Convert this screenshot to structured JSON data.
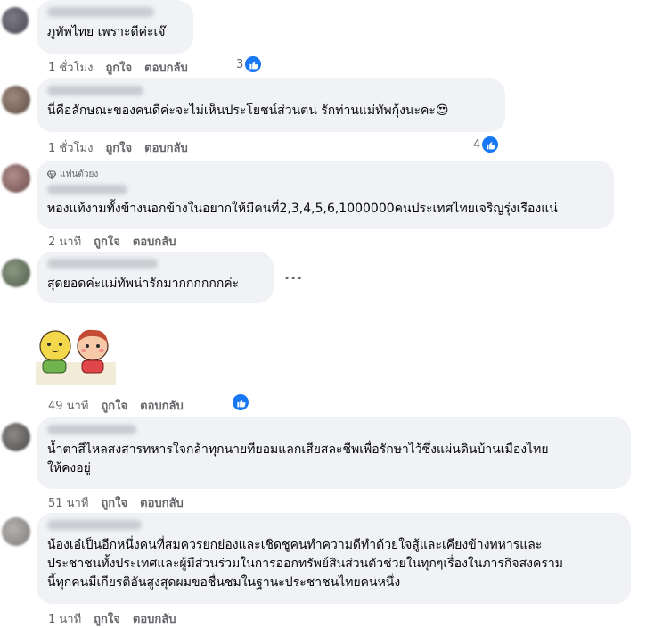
{
  "comments": [
    {
      "text": "ภูทัพไทย เพราะดีค่ะเจ๊",
      "time": "1 ชั่วโมง",
      "like": "ถูกใจ",
      "reply": "ตอบกลับ",
      "reactions": "3"
    },
    {
      "text": "นี่คือลักษณะของคนดีค่ะจะไม่เห็นประโยชน์ส่วนตน รักท่านแม่ทัพกุ้งนะคะ😍",
      "time": "1 ชั่วโมง",
      "like": "ถูกใจ",
      "reply": "ตอบกลับ",
      "reactions": "4"
    },
    {
      "badge": "แฟนตัวยง",
      "text": "ทองแท้งามทั้งข้างนอกข้างในอยากให้มีคนที่2,3,4,5,6,1000000คนประเทศไทยเจริญรุ่งเรืองแน่",
      "time": "2 นาที",
      "like": "ถูกใจ",
      "reply": "ตอบกลับ"
    },
    {
      "text": "สุดยอดค่ะแม่ทัพน่ารักมากกกกกกค่ะ",
      "more": "..."
    },
    {
      "time": "49 นาที",
      "like": "ถูกใจ",
      "reply": "ตอบกลับ"
    },
    {
      "text": "น้ำตาสีไหลสงสารทหารใจกล้าทุกนายทียอมแลกเสียสละชีพเพื่อรักษาไว้ซึ่งแผ่นดินบ้านเมืองไทย\nให้คงอยู่",
      "time": "51 นาที",
      "like": "ถูกใจ",
      "reply": "ตอบกลับ"
    },
    {
      "text": "น้องเอ๋เป็นอีกหนึ่งคนที่สมควรยกย่องและเชิดชูคนทำความดีทำด้วยใจสู้และเคียงข้างทหารและ\nประชาชนทั้งประเทศและผู้มีส่วนร่วมในการออกทรัพย์สินส่วนตัวช่วยในทุกๆเรื่องในภารกิจสงคราม\nนี้ทุกคนมีเกียรติอันสูงสุดผมขอชื่นชมในฐานะประชาชนไทยคนหนึ่ง",
      "time": "1 นาที",
      "like": "ถูกใจ",
      "reply": "ตอบกลับ"
    }
  ],
  "colors": {
    "bubble": "#f0f2f5",
    "meta": "#65676b",
    "like_blue": "#1877f2"
  },
  "icons": [
    "like-icon",
    "diamond-icon",
    "more-options-icon",
    "sticker"
  ]
}
